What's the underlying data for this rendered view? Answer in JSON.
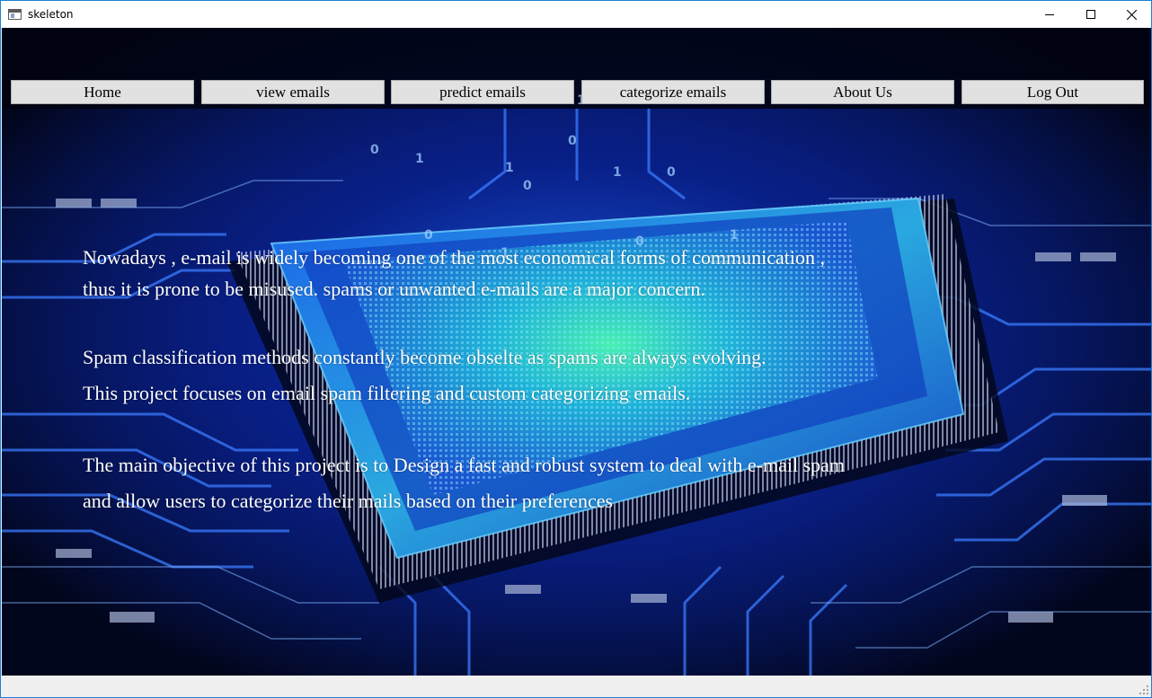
{
  "window": {
    "title": "skeleton"
  },
  "nav": {
    "items": [
      {
        "label": "Home"
      },
      {
        "label": "view emails"
      },
      {
        "label": "predict emails"
      },
      {
        "label": "categorize emails"
      },
      {
        "label": "About Us"
      },
      {
        "label": "Log Out"
      }
    ]
  },
  "content": {
    "paragraphs": [
      {
        "lines": [
          "Nowadays , e-mail is widely becoming one of the most economical forms of communication ,",
          "thus it is prone to be misused. spams or unwanted e-mails are a major concern."
        ]
      },
      {
        "lines": [
          "Spam classification methods constantly become obselte as spams are always evolving.",
          "This project focuses on email spam filtering and custom categorizing emails."
        ]
      },
      {
        "lines": [
          "The main objective of this project is to Design a fast and robust system to deal with e-mail spam",
          "and allow users to categorize their mails based on their preferences"
        ]
      }
    ]
  },
  "background": {
    "description_icon": "circuit-board-cpu-image",
    "accent": "#2a4bff",
    "glow": "#39e6a8"
  }
}
